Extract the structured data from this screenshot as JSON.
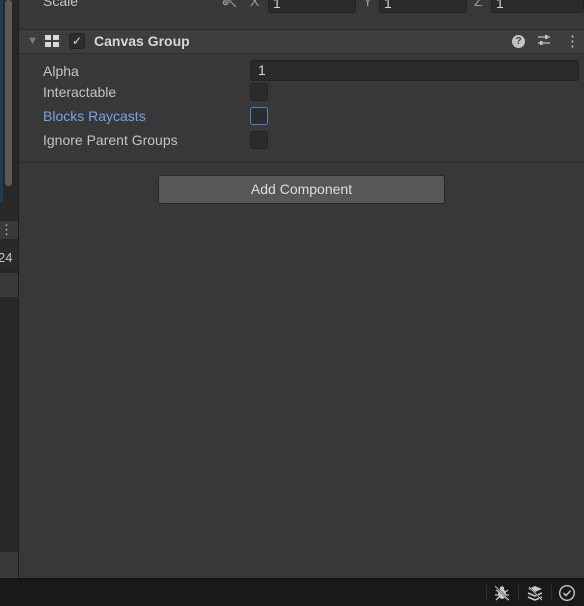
{
  "transform": {
    "scale_label": "Scale",
    "axis_x": "X",
    "axis_y": "Y",
    "axis_z": "Z",
    "value_x": "1",
    "value_y": "1",
    "value_z": "1"
  },
  "left_panel": {
    "kebab": "⋮",
    "value_fragment": "24"
  },
  "component": {
    "title": "Canvas Group",
    "enabled": true,
    "properties": {
      "alpha_label": "Alpha",
      "alpha_value": "1",
      "interactable_label": "Interactable",
      "blocks_raycasts_label": "Blocks Raycasts",
      "ignore_parent_label": "Ignore Parent Groups"
    }
  },
  "add_component_label": "Add Component",
  "status_bar_icons": [
    "bug-icon",
    "layers-icon",
    "check-circle-icon"
  ],
  "colors": {
    "highlight_text": "#6fa8e6",
    "focus_border": "#4b86c9",
    "background": "#383838"
  }
}
